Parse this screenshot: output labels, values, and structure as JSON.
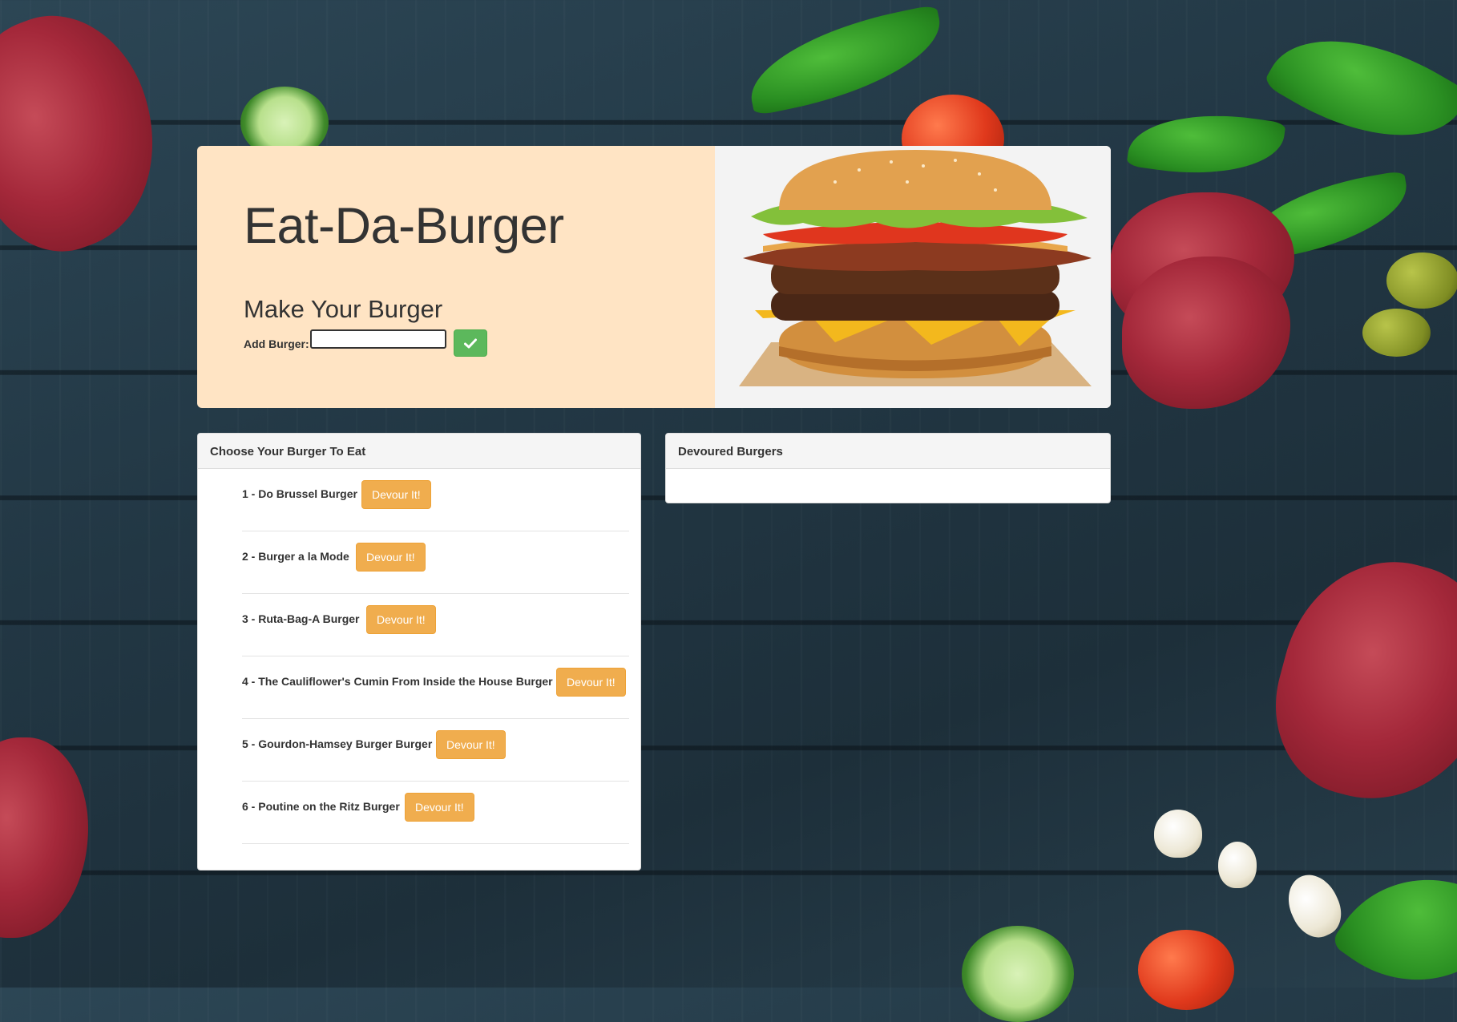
{
  "header": {
    "title": "Eat-Da-Burger",
    "subtitle": "Make Your Burger",
    "add_label": "Add Burger:",
    "input_value": "",
    "submit_icon": "check-icon"
  },
  "to_eat": {
    "heading": "Choose Your Burger To Eat",
    "button_label": "Devour It!",
    "items": [
      {
        "label": "1 - Do Brussel Burger"
      },
      {
        "label": "2 - Burger a la Mode"
      },
      {
        "label": "3 - Ruta-Bag-A Burger"
      },
      {
        "label": "4 - The Cauliflower's Cumin From Inside the House Burger"
      },
      {
        "label": "5 - Gourdon-Hamsey Burger Burger"
      },
      {
        "label": "6 - Poutine on the Ritz Burger"
      }
    ]
  },
  "devoured": {
    "heading": "Devoured Burgers",
    "items": []
  },
  "colors": {
    "jumbotron_bg": "#ffe4c4",
    "devour_button": "#f0ad4e",
    "submit_button": "#5cb85c",
    "background": "#2c4655"
  }
}
